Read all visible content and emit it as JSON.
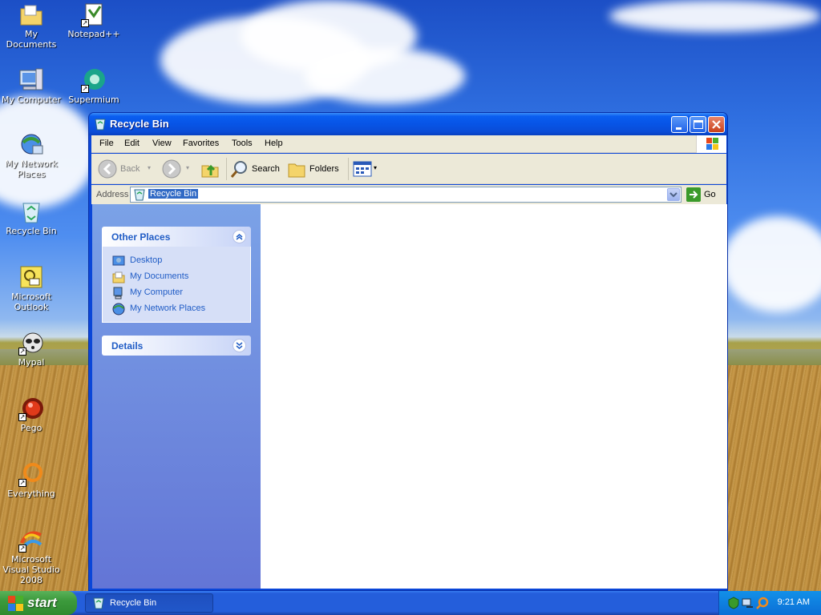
{
  "desktop": {
    "icons": [
      {
        "label": "My Documents"
      },
      {
        "label": "Notepad++"
      },
      {
        "label": "My Computer"
      },
      {
        "label": "Supermium"
      },
      {
        "label": "My Network Places"
      },
      {
        "label": "Recycle Bin"
      },
      {
        "label": "Microsoft Outlook"
      },
      {
        "label": "Mypal"
      },
      {
        "label": "Pego"
      },
      {
        "label": "Everything"
      },
      {
        "label": "Microsoft Visual Studio 2008"
      }
    ]
  },
  "window": {
    "title": "Recycle Bin",
    "menu": [
      "File",
      "Edit",
      "View",
      "Favorites",
      "Tools",
      "Help"
    ],
    "toolbar": {
      "back": "Back",
      "search": "Search",
      "folders": "Folders"
    },
    "address": {
      "label": "Address",
      "value": "Recycle Bin",
      "go": "Go"
    },
    "other_places": {
      "title": "Other Places",
      "items": [
        {
          "label": "Desktop",
          "icon": "desktop-icon"
        },
        {
          "label": "My Documents",
          "icon": "folder-icon"
        },
        {
          "label": "My Computer",
          "icon": "computer-icon"
        },
        {
          "label": "My Network Places",
          "icon": "network-icon"
        }
      ]
    },
    "details": {
      "title": "Details"
    }
  },
  "taskbar": {
    "start": "start",
    "task": "Recycle Bin",
    "clock": "9:21 AM"
  },
  "colors": {
    "title_bar": "#0754e6",
    "taskbar": "#245edb",
    "start_green": "#3c9a3c",
    "link_blue": "#215dc6"
  }
}
